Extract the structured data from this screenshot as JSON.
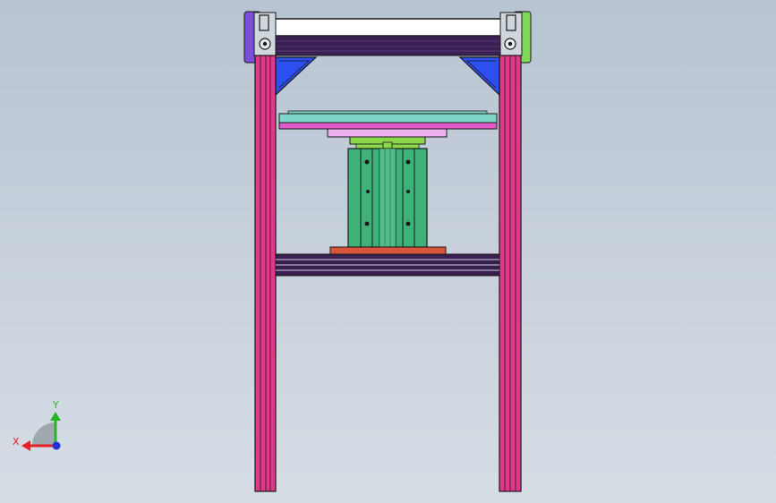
{
  "viewport": {
    "background_top": "#b8c4d2",
    "background_bottom": "#d6dde5"
  },
  "triad": {
    "x_label": "X",
    "y_label": "Y",
    "x_color": "#e8202a",
    "y_color": "#28b428",
    "z_color": "#2030d8"
  },
  "colors": {
    "upright": "#e0388a",
    "top_beam": "#3a1f52",
    "bottom_beam": "#3a1f52",
    "corner_left": "#7a4fd8",
    "corner_right": "#7fd85a",
    "gusset": "#2b4ff0",
    "plate_cyan": "#7fd6c8",
    "plate_magenta": "#e05ac8",
    "plate_pink": "#eeb0ee",
    "coupler": "#8cd84a",
    "guide_body": "#3fb27a",
    "base_plate": "#d8553a",
    "outline": "#1a1a1a"
  }
}
